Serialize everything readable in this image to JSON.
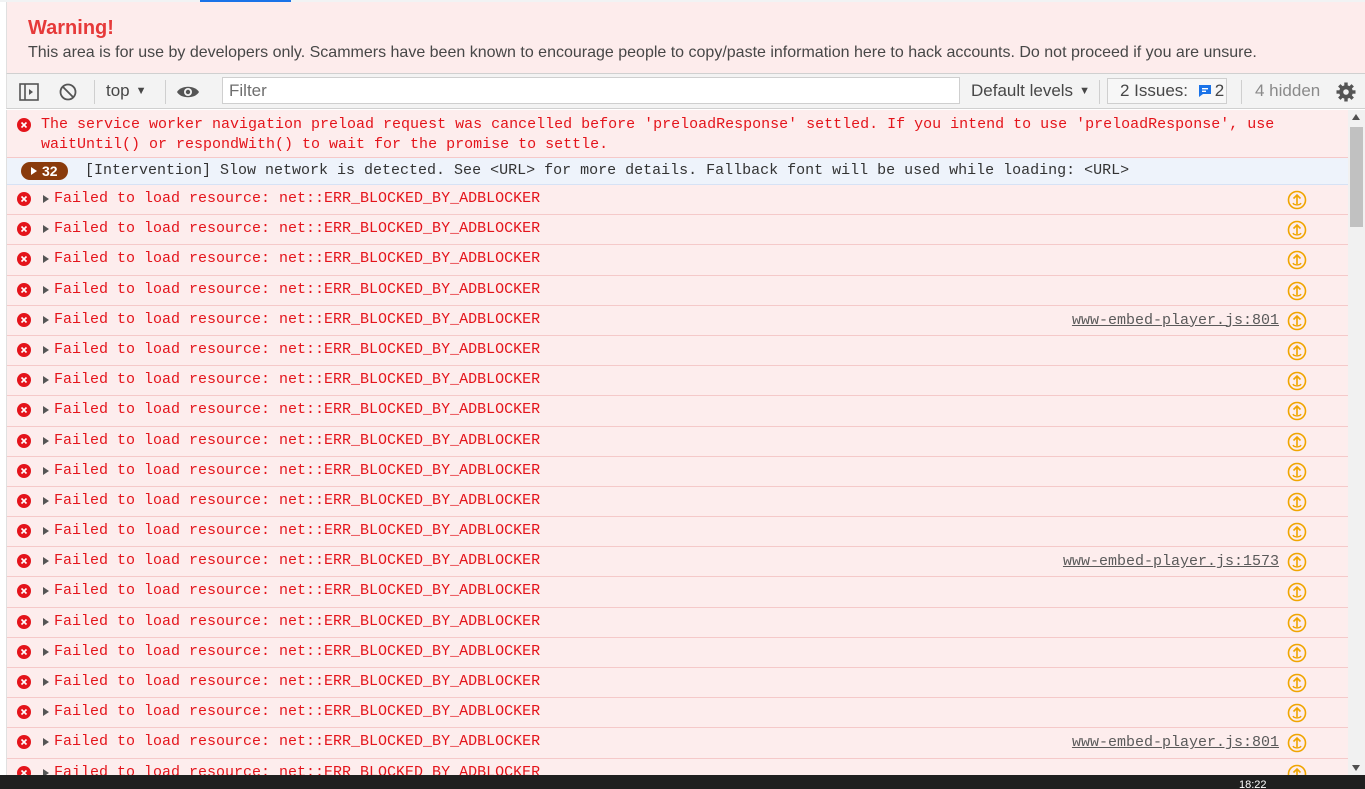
{
  "warning": {
    "title": "Warning!",
    "text": "This area is for use by developers only. Scammers have been known to encourage people to copy/paste information here to hack accounts. Do not proceed if you are unsure."
  },
  "toolbar": {
    "context": "top",
    "filter_placeholder": "Filter",
    "levels_label": "Default levels",
    "issues_label": "2 Issues:",
    "issues_count": "2",
    "hidden_label": "4 hidden"
  },
  "messages": {
    "service_worker": "The service worker navigation preload request was cancelled before 'preloadResponse' settled. If you intend to use 'preloadResponse', use waitUntil() or respondWith() to wait for the promise to settle.",
    "intervention_count": "32",
    "intervention": "[Intervention] Slow network is detected. See <URL> for more details. Fallback font will be used while loading: <URL>",
    "error_text": "Failed to load resource: net::ERR_BLOCKED_BY_ADBLOCKER",
    "error_rows": [
      {
        "source": ""
      },
      {
        "source": ""
      },
      {
        "source": ""
      },
      {
        "source": ""
      },
      {
        "source": "www-embed-player.js:801"
      },
      {
        "source": ""
      },
      {
        "source": ""
      },
      {
        "source": ""
      },
      {
        "source": ""
      },
      {
        "source": ""
      },
      {
        "source": ""
      },
      {
        "source": ""
      },
      {
        "source": "www-embed-player.js:1573"
      },
      {
        "source": ""
      },
      {
        "source": ""
      },
      {
        "source": ""
      },
      {
        "source": ""
      },
      {
        "source": ""
      },
      {
        "source": "www-embed-player.js:801"
      },
      {
        "source": ""
      }
    ]
  },
  "taskbar": {
    "clock": "18:22"
  },
  "colors": {
    "error_text": "#e4141b",
    "error_bg": "#fdeded",
    "warning_title": "#e63a3a",
    "reload_icon": "#f0a500",
    "badge_bg": "#8a3b0c"
  }
}
